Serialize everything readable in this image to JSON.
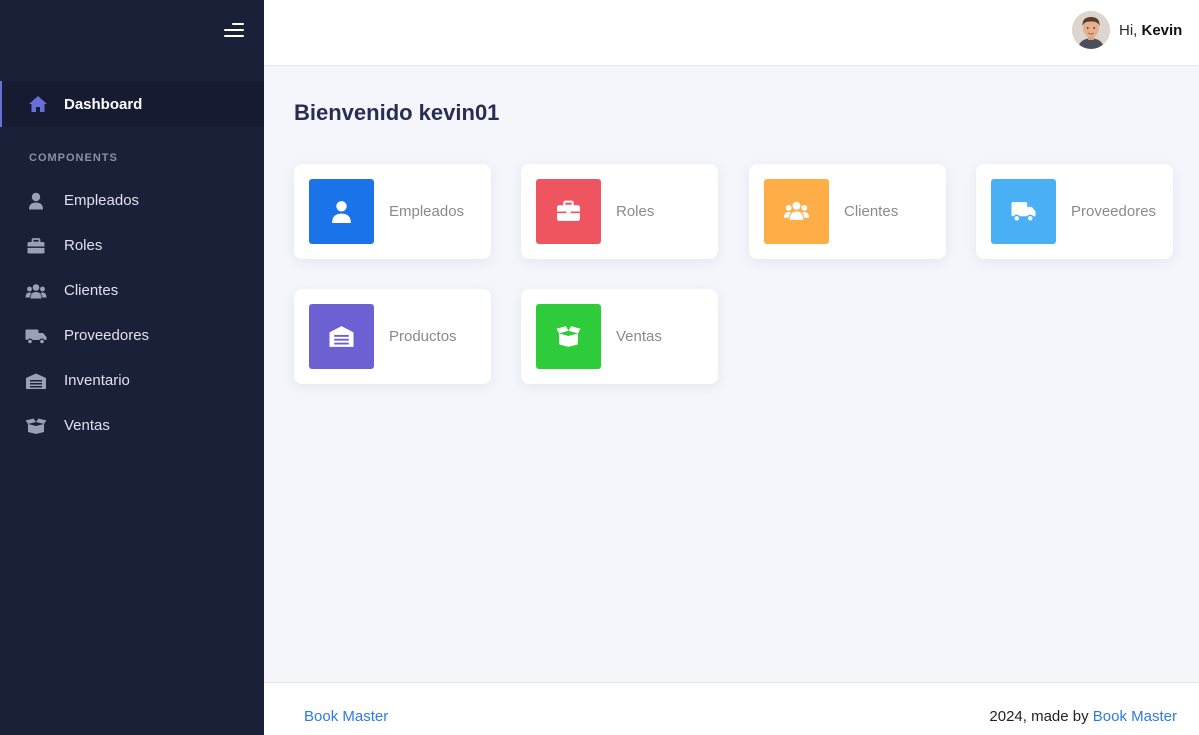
{
  "sidebar": {
    "toggle_icon": "menu-icon",
    "active": {
      "label": "Dashboard",
      "icon": "home-icon",
      "accent": "#6a6fd8"
    },
    "section_title": "COMPONENTS",
    "items": [
      {
        "label": "Empleados",
        "icon": "user-icon"
      },
      {
        "label": "Roles",
        "icon": "briefcase-icon"
      },
      {
        "label": "Clientes",
        "icon": "users-icon"
      },
      {
        "label": "Proveedores",
        "icon": "truck-icon"
      },
      {
        "label": "Inventario",
        "icon": "warehouse-icon"
      },
      {
        "label": "Ventas",
        "icon": "box-open-icon"
      }
    ]
  },
  "header": {
    "greeting_prefix": "Hi, ",
    "user_name": "Kevin"
  },
  "main": {
    "title": "Bienvenido kevin01",
    "cards": [
      {
        "label": "Empleados",
        "icon": "user-icon",
        "color": "#1a73e8"
      },
      {
        "label": "Roles",
        "icon": "briefcase-icon",
        "color": "#ef5461"
      },
      {
        "label": "Clientes",
        "icon": "users-icon",
        "color": "#ffad46"
      },
      {
        "label": "Proveedores",
        "icon": "truck-icon",
        "color": "#4ab0f5"
      },
      {
        "label": "Productos",
        "icon": "warehouse-icon",
        "color": "#6c60d3"
      },
      {
        "label": "Ventas",
        "icon": "box-open-icon",
        "color": "#2ecc3b"
      }
    ]
  },
  "footer": {
    "brand": "Book Master",
    "credit_prefix": "2024, made by ",
    "credit_link": "Book Master",
    "link_color": "#2c7be5"
  }
}
